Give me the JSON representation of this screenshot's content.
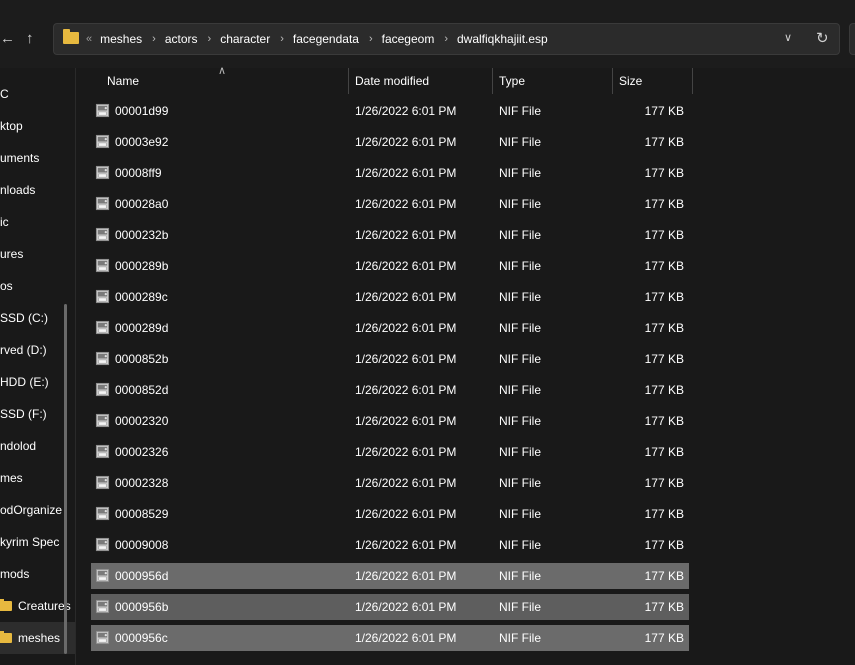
{
  "window": {
    "title": "dwalfiqkhajiit.esp"
  },
  "address_bar": {
    "overflow": "«",
    "breadcrumbs": [
      "meshes",
      "actors",
      "character",
      "facegendata",
      "facegeom",
      "dwalfiqkhajiit.esp"
    ]
  },
  "nav": {
    "back": "←",
    "up": "↑"
  },
  "sidebar": {
    "items": [
      {
        "label": "C"
      },
      {
        "label": "ktop"
      },
      {
        "label": "uments"
      },
      {
        "label": "nloads"
      },
      {
        "label": "ic"
      },
      {
        "label": "ures"
      },
      {
        "label": "os"
      },
      {
        "label": "SSD (C:)"
      },
      {
        "label": "rved (D:)"
      },
      {
        "label": "HDD (E:)"
      },
      {
        "label": " SSD (F:)"
      },
      {
        "label": "ndolod"
      },
      {
        "label": "mes"
      },
      {
        "label": "odOrganize"
      },
      {
        "label": "kyrim Spec"
      },
      {
        "label": "mods"
      },
      {
        "label": "Creatures"
      },
      {
        "label": "meshes"
      }
    ]
  },
  "columns": {
    "name": "Name",
    "date": "Date modified",
    "type": "Type",
    "size": "Size"
  },
  "files": [
    {
      "name": "00001d99",
      "date": "1/26/2022 6:01 PM",
      "type": "NIF File",
      "size": "177 KB"
    },
    {
      "name": "00003e92",
      "date": "1/26/2022 6:01 PM",
      "type": "NIF File",
      "size": "177 KB"
    },
    {
      "name": "00008ff9",
      "date": "1/26/2022 6:01 PM",
      "type": "NIF File",
      "size": "177 KB"
    },
    {
      "name": "000028a0",
      "date": "1/26/2022 6:01 PM",
      "type": "NIF File",
      "size": "177 KB"
    },
    {
      "name": "0000232b",
      "date": "1/26/2022 6:01 PM",
      "type": "NIF File",
      "size": "177 KB"
    },
    {
      "name": "0000289b",
      "date": "1/26/2022 6:01 PM",
      "type": "NIF File",
      "size": "177 KB"
    },
    {
      "name": "0000289c",
      "date": "1/26/2022 6:01 PM",
      "type": "NIF File",
      "size": "177 KB"
    },
    {
      "name": "0000289d",
      "date": "1/26/2022 6:01 PM",
      "type": "NIF File",
      "size": "177 KB"
    },
    {
      "name": "0000852b",
      "date": "1/26/2022 6:01 PM",
      "type": "NIF File",
      "size": "177 KB"
    },
    {
      "name": "0000852d",
      "date": "1/26/2022 6:01 PM",
      "type": "NIF File",
      "size": "177 KB"
    },
    {
      "name": "00002320",
      "date": "1/26/2022 6:01 PM",
      "type": "NIF File",
      "size": "177 KB"
    },
    {
      "name": "00002326",
      "date": "1/26/2022 6:01 PM",
      "type": "NIF File",
      "size": "177 KB"
    },
    {
      "name": "00002328",
      "date": "1/26/2022 6:01 PM",
      "type": "NIF File",
      "size": "177 KB"
    },
    {
      "name": "00008529",
      "date": "1/26/2022 6:01 PM",
      "type": "NIF File",
      "size": "177 KB"
    },
    {
      "name": "00009008",
      "date": "1/26/2022 6:01 PM",
      "type": "NIF File",
      "size": "177 KB"
    },
    {
      "name": "0000956d",
      "date": "1/26/2022 6:01 PM",
      "type": "NIF File",
      "size": "177 KB",
      "selected": true
    },
    {
      "name": "0000956b",
      "date": "1/26/2022 6:01 PM",
      "type": "NIF File",
      "size": "177 KB",
      "selected": true
    },
    {
      "name": "0000956c",
      "date": "1/26/2022 6:01 PM",
      "type": "NIF File",
      "size": "177 KB",
      "selected": true
    }
  ],
  "colors": {
    "background": "#191919",
    "selection": "#6b6b6b",
    "folder": "#e7b93f"
  }
}
